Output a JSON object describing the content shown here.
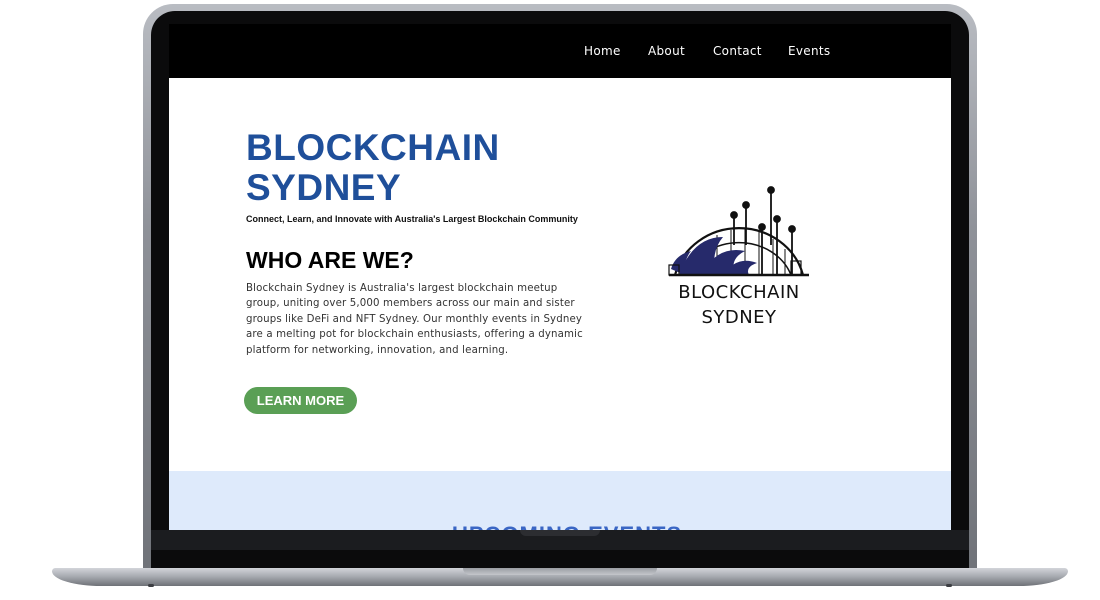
{
  "nav": {
    "items": [
      "Home",
      "About",
      "Contact",
      "Events"
    ]
  },
  "hero": {
    "title": "BLOCKCHAIN SYDNEY",
    "tagline": "Connect, Learn, and Innovate with Australia's Largest Blockchain Community"
  },
  "about": {
    "heading": "WHO ARE WE?",
    "body": "Blockchain Sydney is Australia's largest blockchain meetup group, uniting over 5,000 members across our main and sister groups like DeFi and NFT Sydney. Our monthly events in Sydney are a melting pot for blockchain enthusiasts, offering a dynamic platform for networking, innovation, and learning.",
    "button_label": "LEARN MORE"
  },
  "logo": {
    "line1": "BLOCKCHAIN",
    "line2": "SYDNEY",
    "icon": "sydney-harbour-bridge-opera-house-logo"
  },
  "events": {
    "heading": "UPCOMING EVENTS"
  },
  "colors": {
    "nav_bg": "#000000",
    "title_blue": "#1f4f9a",
    "button_green": "#5a9f55",
    "events_band": "#deeafb",
    "logo_navy": "#262a6b"
  }
}
